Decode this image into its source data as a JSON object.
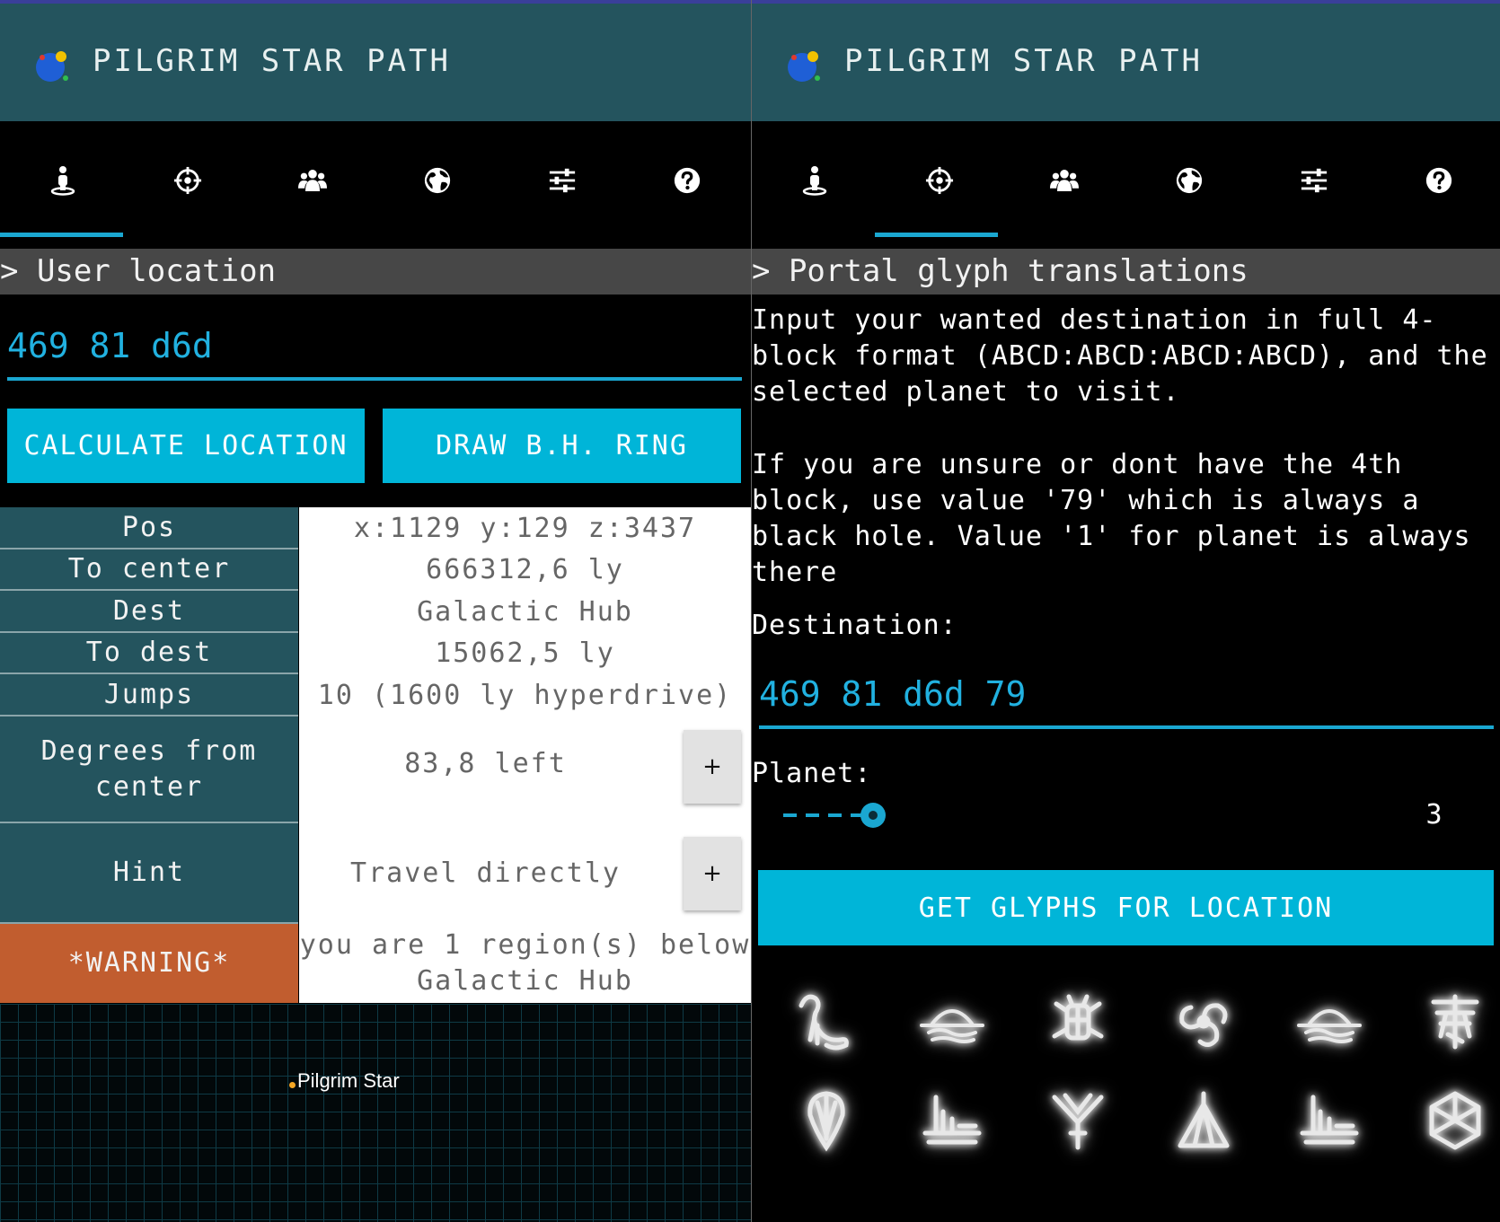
{
  "app": {
    "title": "PILGRIM STAR PATH",
    "colors": {
      "appbar": "#24545e",
      "accent": "#1aa7d1",
      "button": "#00b5d8",
      "warning": "#c15d2f",
      "header": "#474747"
    }
  },
  "tabs": [
    {
      "icon": "person-location-icon"
    },
    {
      "icon": "crosshair-icon"
    },
    {
      "icon": "group-icon"
    },
    {
      "icon": "globe-icon"
    },
    {
      "icon": "sliders-icon"
    },
    {
      "icon": "help-icon"
    }
  ],
  "left": {
    "active_tab": 0,
    "section_title": "> User location",
    "coords_value": "469 81 d6d",
    "buttons": {
      "calculate": "CALCULATE LOCATION",
      "draw_ring": "DRAW B.H. RING"
    },
    "table": [
      {
        "label": "Pos",
        "value": "x:1129 y:129 z:3437"
      },
      {
        "label": "To center",
        "value": "666312,6 ly"
      },
      {
        "label": "Dest",
        "value": "Galactic Hub"
      },
      {
        "label": "To dest",
        "value": "15062,5 ly"
      },
      {
        "label": "Jumps",
        "value": "10 (1600 ly hyperdrive)"
      },
      {
        "label": "Degrees from\ncenter",
        "value": "83,8 left",
        "expand": "+"
      },
      {
        "label": "Hint",
        "value": "Travel directly",
        "expand": "+"
      },
      {
        "label": "*WARNING*",
        "value": "you are 1 region(s) below\nGalactic Hub"
      }
    ],
    "map": {
      "star_label": "Pilgrim Star"
    }
  },
  "right": {
    "active_tab": 1,
    "section_title": "> Portal glyph translations",
    "instructions_1": "Input your wanted destination in full 4-\nblock format (ABCD:ABCD:ABCD:ABCD), and the\nselected planet to visit.",
    "instructions_2": "If you are unsure or dont have the 4th\nblock, use value '79' which is always a\nblack hole. Value '1' for planet is always\nthere",
    "destination_label": "Destination:",
    "destination_value": "469 81 d6d 79",
    "planet_label": "Planet:",
    "planet_value": "3",
    "get_glyphs_button": "GET GLYPHS FOR LOCATION",
    "glyphs": [
      {
        "icon": "glyph-sunset-icon"
      },
      {
        "icon": "glyph-eclipse-icon"
      },
      {
        "icon": "glyph-bug-icon"
      },
      {
        "icon": "glyph-vortex-icon"
      },
      {
        "icon": "glyph-eclipse-icon"
      },
      {
        "icon": "glyph-dragonfly-icon"
      },
      {
        "icon": "glyph-balloon-icon"
      },
      {
        "icon": "glyph-boat-icon"
      },
      {
        "icon": "glyph-tree-icon"
      },
      {
        "icon": "glyph-tent-icon"
      },
      {
        "icon": "glyph-boat-icon"
      },
      {
        "icon": "glyph-hexagon-icon"
      }
    ]
  }
}
